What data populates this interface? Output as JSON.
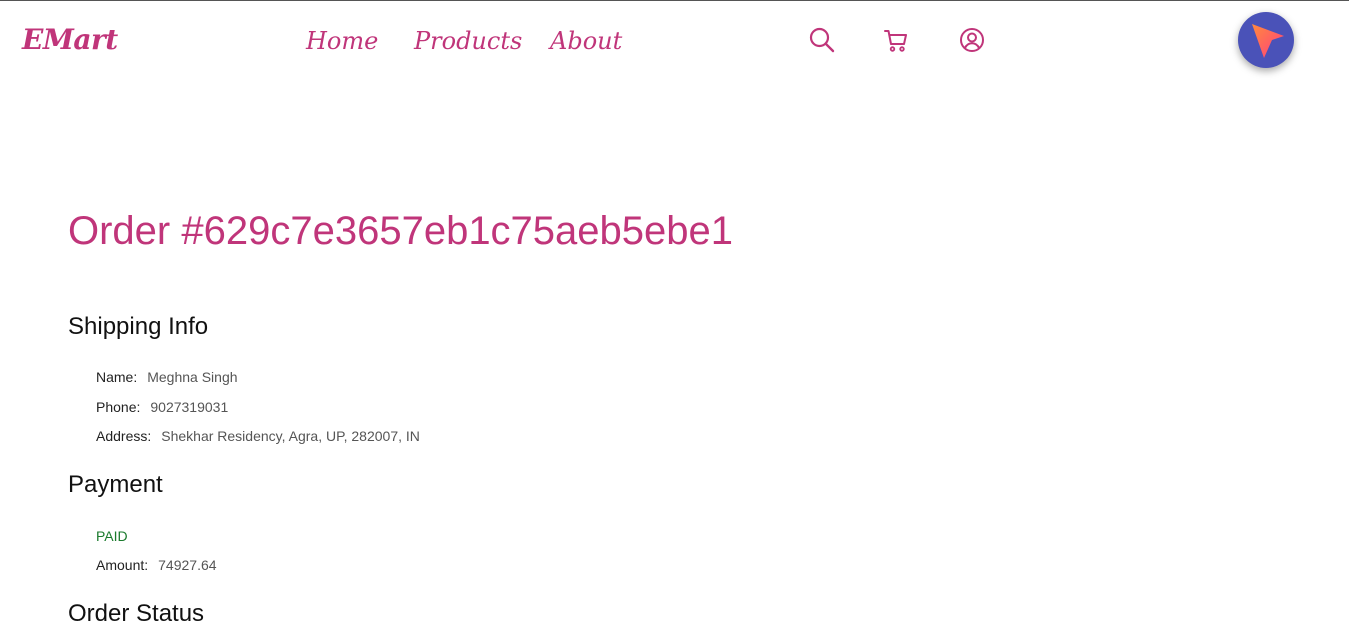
{
  "header": {
    "logo": "EMart",
    "nav": {
      "home": "Home",
      "products": "Products",
      "about": "About"
    },
    "icons": [
      "search-icon",
      "cart-icon",
      "user-icon",
      "navigation-fab-icon"
    ],
    "accent_color": "#c0357a"
  },
  "order": {
    "title": "Order #629c7e3657eb1c75aeb5ebe1"
  },
  "shipping": {
    "heading": "Shipping Info",
    "name_label": "Name:",
    "name_value": "Meghna Singh",
    "phone_label": "Phone:",
    "phone_value": "9027319031",
    "address_label": "Address:",
    "address_value": "Shekhar Residency, Agra, UP, 282007, IN"
  },
  "payment": {
    "heading": "Payment",
    "status": "PAID",
    "status_color": "#1a7a2c",
    "amount_label": "Amount:",
    "amount_value": "74927.64"
  },
  "order_status": {
    "heading": "Order Status"
  }
}
